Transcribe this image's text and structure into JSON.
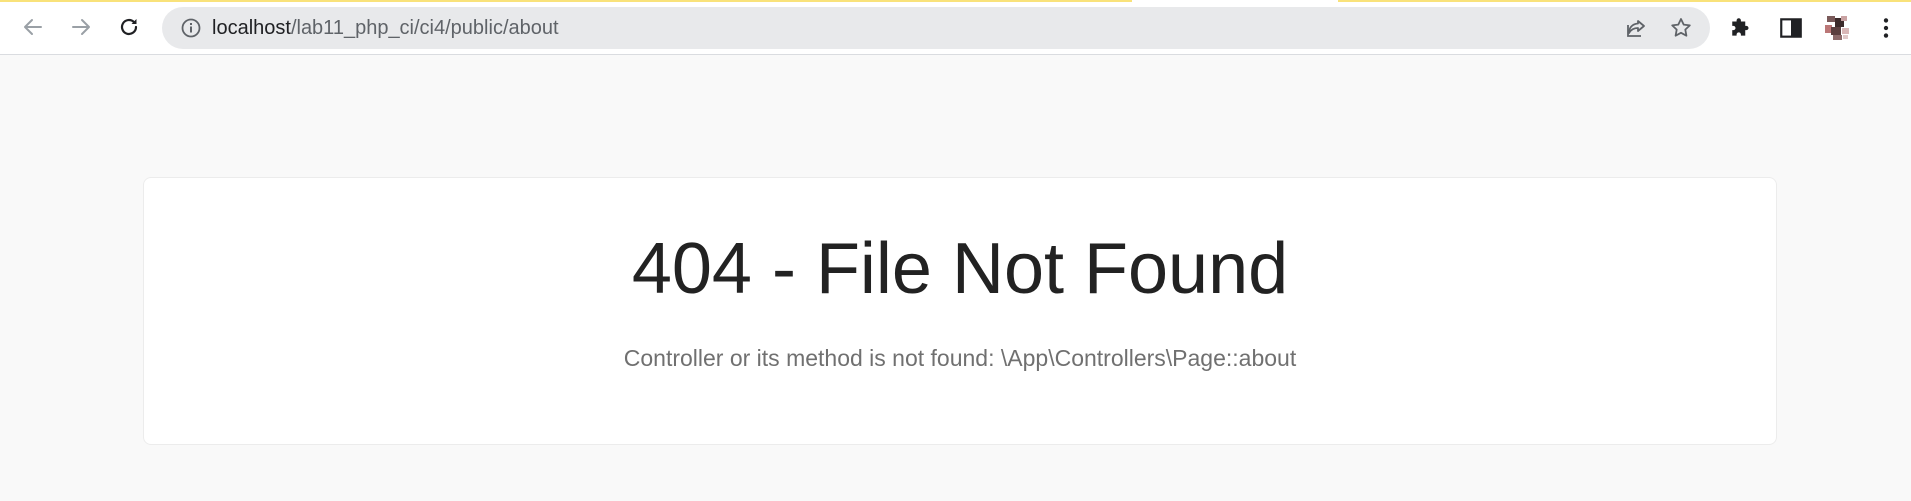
{
  "browser": {
    "url_host": "localhost",
    "url_path": "/lab11_php_ci/ci4/public/about",
    "icons": {
      "back": "arrow-left-icon",
      "forward": "arrow-right-icon",
      "reload": "reload-icon",
      "site_info": "info-icon",
      "share": "share-icon",
      "bookmark": "star-icon",
      "extensions": "puzzle-icon",
      "side_panel": "side-panel-icon",
      "profile": "avatar",
      "menu": "kebab-menu-icon"
    },
    "colors": {
      "toolbar": "#ffffff",
      "omnibox": "#e8e9eb",
      "loading_bar": "#f9e27a"
    }
  },
  "page": {
    "title": "404 - File Not Found",
    "message": "Controller or its method is not found: \\App\\Controllers\\Page::about",
    "colors": {
      "background": "#f9f9f9",
      "card": "#ffffff",
      "title": "#222222",
      "message": "#707070"
    }
  }
}
